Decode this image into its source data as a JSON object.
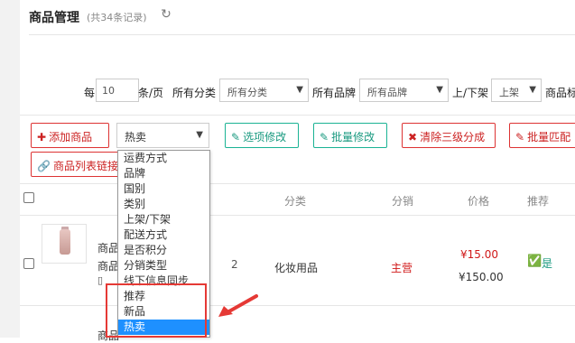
{
  "page": {
    "title": "商品管理",
    "record_count": "(共34条记录)",
    "refresh_icon": "refresh-icon"
  },
  "filters": {
    "per_page_prefix": "每",
    "per_page_value": "10",
    "per_page_suffix": "条/页",
    "category_label": "所有分类",
    "category_value": "所有分类",
    "brand_label": "所有品牌",
    "brand_value": "所有品牌",
    "shelf_label": "上/下架",
    "shelf_value": "上架",
    "tag_label": "商品标"
  },
  "toolbar": {
    "add_label": "添加商品",
    "hot_select_value": "热卖",
    "option_edit_label": "选项修改",
    "batch_edit_label": "批量修改",
    "clear_label": "清除三级分成",
    "batch_match_label": "批量匹配",
    "list_link_label": "商品列表链接"
  },
  "table": {
    "headers": {
      "category": "分类",
      "commission": "分销",
      "price": "价格",
      "recommend": "推荐"
    },
    "rows": [
      {
        "name": "商品",
        "sub": "商品",
        "code_tail": "2",
        "category": "化妆用品",
        "commission": "主营",
        "price": "¥15.00",
        "orig_price": "¥150.00",
        "recommend": "是"
      },
      {
        "name": "商品"
      }
    ]
  },
  "dropdown": {
    "options": [
      "运费方式",
      "品牌",
      "国别",
      "类别",
      "上架/下架",
      "配送方式",
      "是否积分",
      "分销类型",
      "线下信息同步",
      "推荐",
      "新品",
      "热卖"
    ],
    "selected": "热卖"
  },
  "colors": {
    "accent_red": "#d33",
    "teal": "#1ab394",
    "selected_blue": "#1e90ff",
    "annotation_red": "#e53935"
  }
}
